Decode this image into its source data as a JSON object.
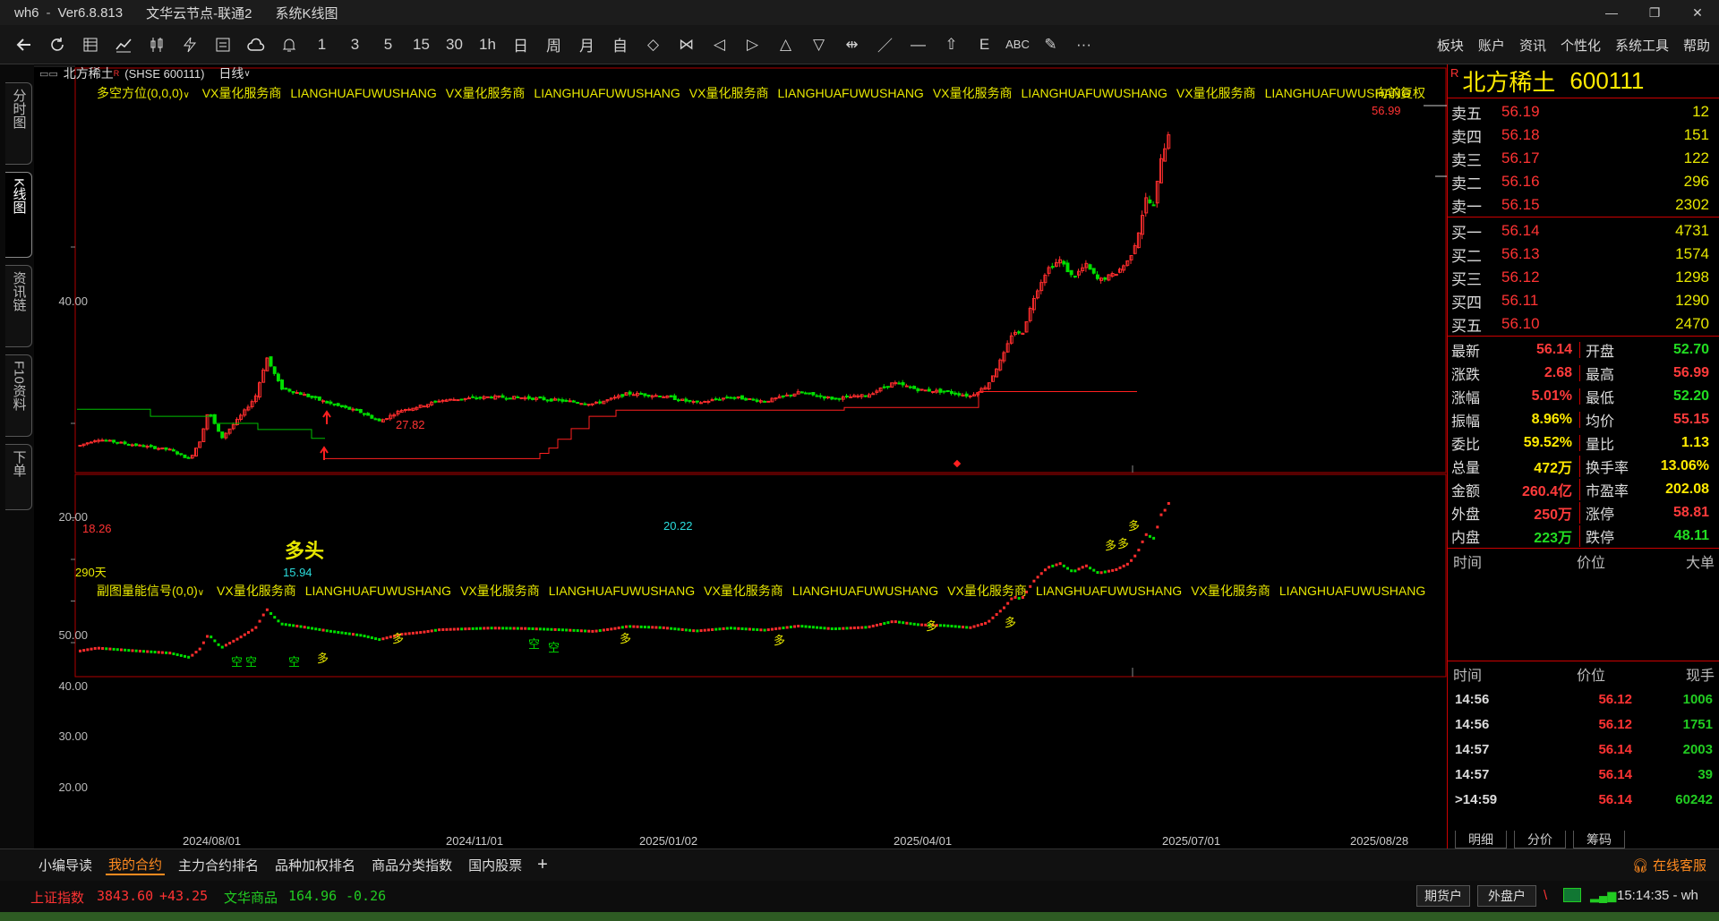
{
  "window": {
    "app": "wh6",
    "version": "Ver6.8.813",
    "server": "文华云节点-联通2",
    "view": "系统K线图",
    "controls": [
      "—",
      "❐",
      "✕"
    ]
  },
  "toolbar": {
    "icons": [
      "back-icon",
      "refresh-icon",
      "table-icon",
      "line-chart-icon",
      "candlestick-icon",
      "lightning-icon",
      "quote-board-icon",
      "cloud-icon",
      "bell-icon"
    ],
    "periods": [
      "1",
      "3",
      "5",
      "15",
      "30",
      "1h",
      "日",
      "周",
      "月",
      "自"
    ],
    "tools": [
      "◇",
      "⋈",
      "◁",
      "▷",
      "△",
      "▽",
      "⇹",
      "／",
      "—",
      "⇧",
      "E",
      "ABC",
      "✎",
      "···"
    ],
    "menus": [
      "板块",
      "账户",
      "资讯",
      "个性化",
      "系统工具",
      "帮助"
    ]
  },
  "left_tabs": [
    "分时图",
    "K线图",
    "资讯链",
    "F10资料",
    "下单"
  ],
  "stock_header": {
    "name": "北方稀土",
    "badge": "R",
    "symbol": "(SHSE 600111)",
    "period": "日线"
  },
  "main_indicator": {
    "name": "多空方位(0,0,0)",
    "tags": [
      "VX量化服务商",
      "LIANGHUAFUWUSHANG",
      "VX量化服务商",
      "LIANGHUAFUWUSHANG",
      "VX量化服务商",
      "LIANGHUAFUWUSHANG",
      "VX量化服务商",
      "LIANGHUAFUWUSHANG",
      "VX量化服务商",
      "LIANGHUAFUWUSHANG"
    ],
    "adjust": "向前复权",
    "annotations": {
      "high": "56.99",
      "peak1": "27.82",
      "mid_low": "20.22",
      "start": "18.26",
      "low": "15.94",
      "days": "290天",
      "signal": "多头"
    },
    "y_labels": [
      "40.00",
      "20.00"
    ]
  },
  "sub_indicator": {
    "name": "副图量能信号(0,0)",
    "tags": [
      "VX量化服务商",
      "LIANGHUAFUWUSHANG",
      "VX量化服务商",
      "LIANGHUAFUWUSHANG",
      "VX量化服务商",
      "LIANGHUAFUWUSHANG",
      "VX量化服务商",
      "LIANGHUAFUWUSHANG",
      "VX量化服务商",
      "LIANGHUAFUWUSHANG"
    ],
    "y_labels": [
      "50.00",
      "40.00",
      "30.00",
      "20.00"
    ],
    "signal_long": "多",
    "signal_short": "空"
  },
  "x_labels": [
    "2024/08/01",
    "2024/11/01",
    "2025/01/02",
    "2025/04/01",
    "2025/07/01",
    "2025/08/28"
  ],
  "chart_data": {
    "type": "candlestick",
    "main_ylim": [
      14,
      58
    ],
    "sub_ylim": [
      13,
      58
    ],
    "key_points": [
      {
        "date": "2024/08/01",
        "price": 18.26
      },
      {
        "date": "2024/09",
        "price": 15.94
      },
      {
        "date": "2024/11",
        "price": 27.82
      },
      {
        "date": "2025/01",
        "price": 20.22
      },
      {
        "date": "2025/08/28",
        "price": 56.99
      }
    ]
  },
  "quote": {
    "name": "北方稀土",
    "code": "600111",
    "badge": "R",
    "sells": [
      {
        "label": "卖五",
        "price": "56.19",
        "vol": "12"
      },
      {
        "label": "卖四",
        "price": "56.18",
        "vol": "151"
      },
      {
        "label": "卖三",
        "price": "56.17",
        "vol": "122"
      },
      {
        "label": "卖二",
        "price": "56.16",
        "vol": "296"
      },
      {
        "label": "卖一",
        "price": "56.15",
        "vol": "2302"
      }
    ],
    "buys": [
      {
        "label": "买一",
        "price": "56.14",
        "vol": "4731"
      },
      {
        "label": "买二",
        "price": "56.13",
        "vol": "1574"
      },
      {
        "label": "买三",
        "price": "56.12",
        "vol": "1298"
      },
      {
        "label": "买四",
        "price": "56.11",
        "vol": "1290"
      },
      {
        "label": "买五",
        "price": "56.10",
        "vol": "2470"
      }
    ],
    "stats": [
      {
        "k": "最新",
        "v": "56.14",
        "c": "#ff3b3b",
        "k2": "开盘",
        "v2": "52.70",
        "c2": "#22dd22"
      },
      {
        "k": "涨跌",
        "v": "2.68",
        "c": "#ff3b3b",
        "k2": "最高",
        "v2": "56.99",
        "c2": "#ff3b3b"
      },
      {
        "k": "涨幅",
        "v": "5.01%",
        "c": "#ff3b3b",
        "k2": "最低",
        "v2": "52.20",
        "c2": "#22dd22"
      },
      {
        "k": "振幅",
        "v": "8.96%",
        "c": "#ffea00",
        "k2": "均价",
        "v2": "55.15",
        "c2": "#ff3b3b"
      },
      {
        "k": "委比",
        "v": "59.52%",
        "c": "#ffea00",
        "k2": "量比",
        "v2": "1.13",
        "c2": "#ffea00"
      },
      {
        "k": "总量",
        "v": "472万",
        "c": "#ffea00",
        "k2": "换手率",
        "v2": "13.06%",
        "c2": "#ffea00"
      },
      {
        "k": "金额",
        "v": "260.4亿",
        "c": "#ff3b3b",
        "k2": "市盈率",
        "v2": "202.08",
        "c2": "#ffea00"
      },
      {
        "k": "外盘",
        "v": "250万",
        "c": "#ff3b3b",
        "k2": "涨停",
        "v2": "58.81",
        "c2": "#ff3b3b"
      },
      {
        "k": "内盘",
        "v": "223万",
        "c": "#22dd22",
        "k2": "跌停",
        "v2": "48.11",
        "c2": "#22dd22"
      }
    ],
    "bigorder_header": [
      "时间",
      "价位",
      "大单"
    ],
    "ticks_header": [
      "时间",
      "价位",
      "现手"
    ],
    "ticks": [
      {
        "t": "14:56",
        "p": "56.12",
        "v": "1006"
      },
      {
        "t": "14:56",
        "p": "56.12",
        "v": "1751"
      },
      {
        "t": "14:57",
        "p": "56.14",
        "v": "2003"
      },
      {
        "t": "14:57",
        "p": "56.14",
        "v": "39"
      },
      {
        "t": ">14:59",
        "p": "56.14",
        "v": "60242"
      }
    ],
    "tabs": [
      "明细",
      "分价",
      "筹码"
    ]
  },
  "bottom_tabs": [
    "小编导读",
    "我的合约",
    "主力合约排名",
    "品种加权排名",
    "商品分类指数",
    "国内股票"
  ],
  "bottom_active": "我的合约",
  "service": "在线客服",
  "status": {
    "idx1_name": "上证指数",
    "idx1_value": "3843.60",
    "idx1_change": "+43.25",
    "idx2_name": "文华商品",
    "idx2_value": "164.96",
    "idx2_change": "-0.26",
    "btn1": "期货户",
    "btn2": "外盘户",
    "clock": "15:14:35 - wh"
  }
}
